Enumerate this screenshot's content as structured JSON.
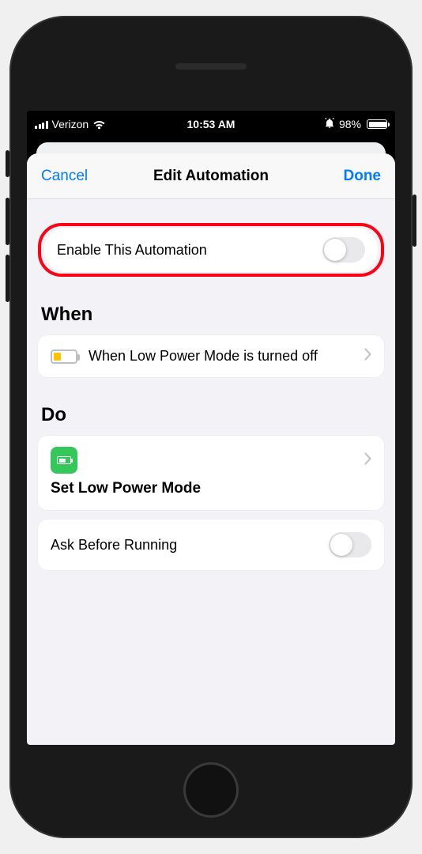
{
  "status_bar": {
    "carrier": "Verizon",
    "time": "10:53 AM",
    "battery_percent": "98%"
  },
  "nav": {
    "cancel": "Cancel",
    "title": "Edit Automation",
    "done": "Done"
  },
  "enable": {
    "label": "Enable This Automation",
    "on": false
  },
  "sections": {
    "when_title": "When",
    "do_title": "Do"
  },
  "when": {
    "description": "When Low Power Mode is turned off"
  },
  "do": {
    "action_label": "Set Low Power Mode"
  },
  "ask": {
    "label": "Ask Before Running",
    "on": false
  },
  "annotation": {
    "highlight_color": "#ff0014"
  }
}
